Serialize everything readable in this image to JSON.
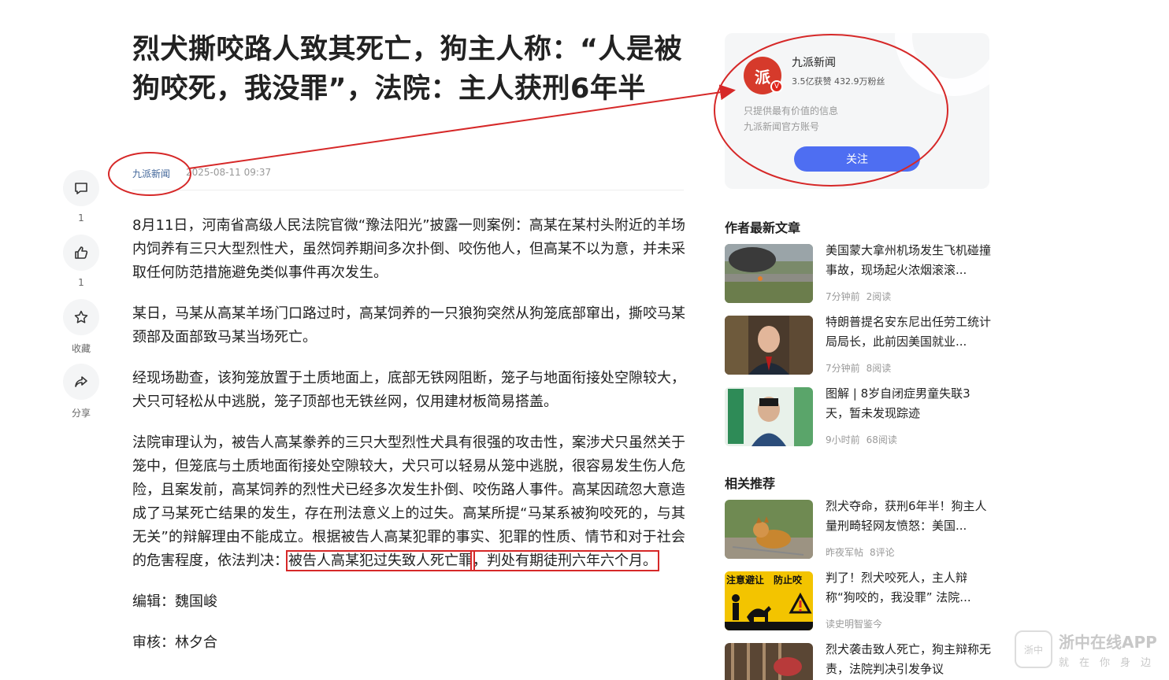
{
  "article": {
    "title": "烈犬撕咬路人致其死亡，狗主人称：“人是被狗咬死，我没罪”，法院：主人获刑6年半",
    "author": "九派新闻",
    "date": "2025-08-11 09:37",
    "paragraphs": [
      "8月11日，河南省高级人民法院官微“豫法阳光”披露一则案例：高某在某村头附近的羊场内饲养有三只大型烈性犬，虽然饲养期间多次扑倒、咬伤他人，但高某不以为意，并未采取任何防范措施避免类似事件再次发生。",
      "某日，马某从高某羊场门口路过时，高某饲养的一只狼狗突然从狗笼底部窜出，撕咬马某颈部及面部致马某当场死亡。",
      "经现场勘查，该狗笼放置于土质地面上，底部无铁网阻断，笼子与地面衔接处空隙较大，犬只可轻松从中逃脱，笼子顶部也无铁丝网，仅用建材板简易搭盖。"
    ],
    "p4_main": "法院审理认为，被告人高某豢养的三只大型烈性犬具有很强的攻击性，案涉犬只虽然关于笼中，但笼底与土质地面衔接处空隙较大，犬只可以轻易从笼中逃脱，很容易发生伤人危险，且案发前，高某饲养的烈性犬已经多次发生扑倒、咬伤路人事件。高某因疏忽大意造成了马某死亡结果的发生，存在刑法意义上的过失。高某所提“马某系被狗咬死的，与其无关”的辩解理由不能成立。根据被告人高某犯罪的事实、犯罪的性质、情节和对于社会的危害程度，依法判决：",
    "p4_hl1": "被告人高某犯过失致人死亡罪",
    "p4_hl2": "，判处有期徒刑六年六个月。",
    "editor": "编辑：魏国峻",
    "reviewer": "审核：林夕合"
  },
  "rail": {
    "comment_count": "1",
    "like_count": "1",
    "collect_label": "收藏",
    "share_label": "分享"
  },
  "author_card": {
    "avatar_text": "派",
    "name": "九派新闻",
    "stats": "3.5亿获赞 432.9万粉丝",
    "desc1": "只提供最有价值的信息",
    "desc2": "九派新闻官方账号",
    "follow_label": "关注"
  },
  "latest": {
    "title": "作者最新文章",
    "items": [
      {
        "title": "美国蒙大拿州机场发生飞机碰撞事故，现场起火浓烟滚滚...",
        "time": "7分钟前",
        "reads": "2阅读"
      },
      {
        "title": "特朗普提名安东尼出任劳工统计局局长，此前因美国就业...",
        "time": "7分钟前",
        "reads": "8阅读"
      },
      {
        "title": "图解 | 8岁自闭症男童失联3天，暂未发现踪迹",
        "time": "9小时前",
        "reads": "68阅读"
      }
    ]
  },
  "related": {
    "title": "相关推荐",
    "items": [
      {
        "title": "烈犬夺命，获刑6年半！狗主人量刑畸轻网友愤怒：美国...",
        "source": "昨夜军帖",
        "comments": "8评论"
      },
      {
        "title": "判了！烈犬咬死人，主人辩称“狗咬的，我没罪” 法院...",
        "source": "读史明智鉴今",
        "comments": "",
        "sign1": "注意避让",
        "sign2": "防止咬"
      },
      {
        "title": "烈犬袭击致人死亡，狗主辩称无责，法院判决引发争议",
        "source": "",
        "comments": ""
      }
    ]
  },
  "watermark": {
    "logo": "浙中",
    "main": "浙中在线APP",
    "sub": "就在你身边"
  },
  "colors": {
    "accent": "#4e6ef2",
    "annotation": "#d62828",
    "author_link": "#406599"
  }
}
